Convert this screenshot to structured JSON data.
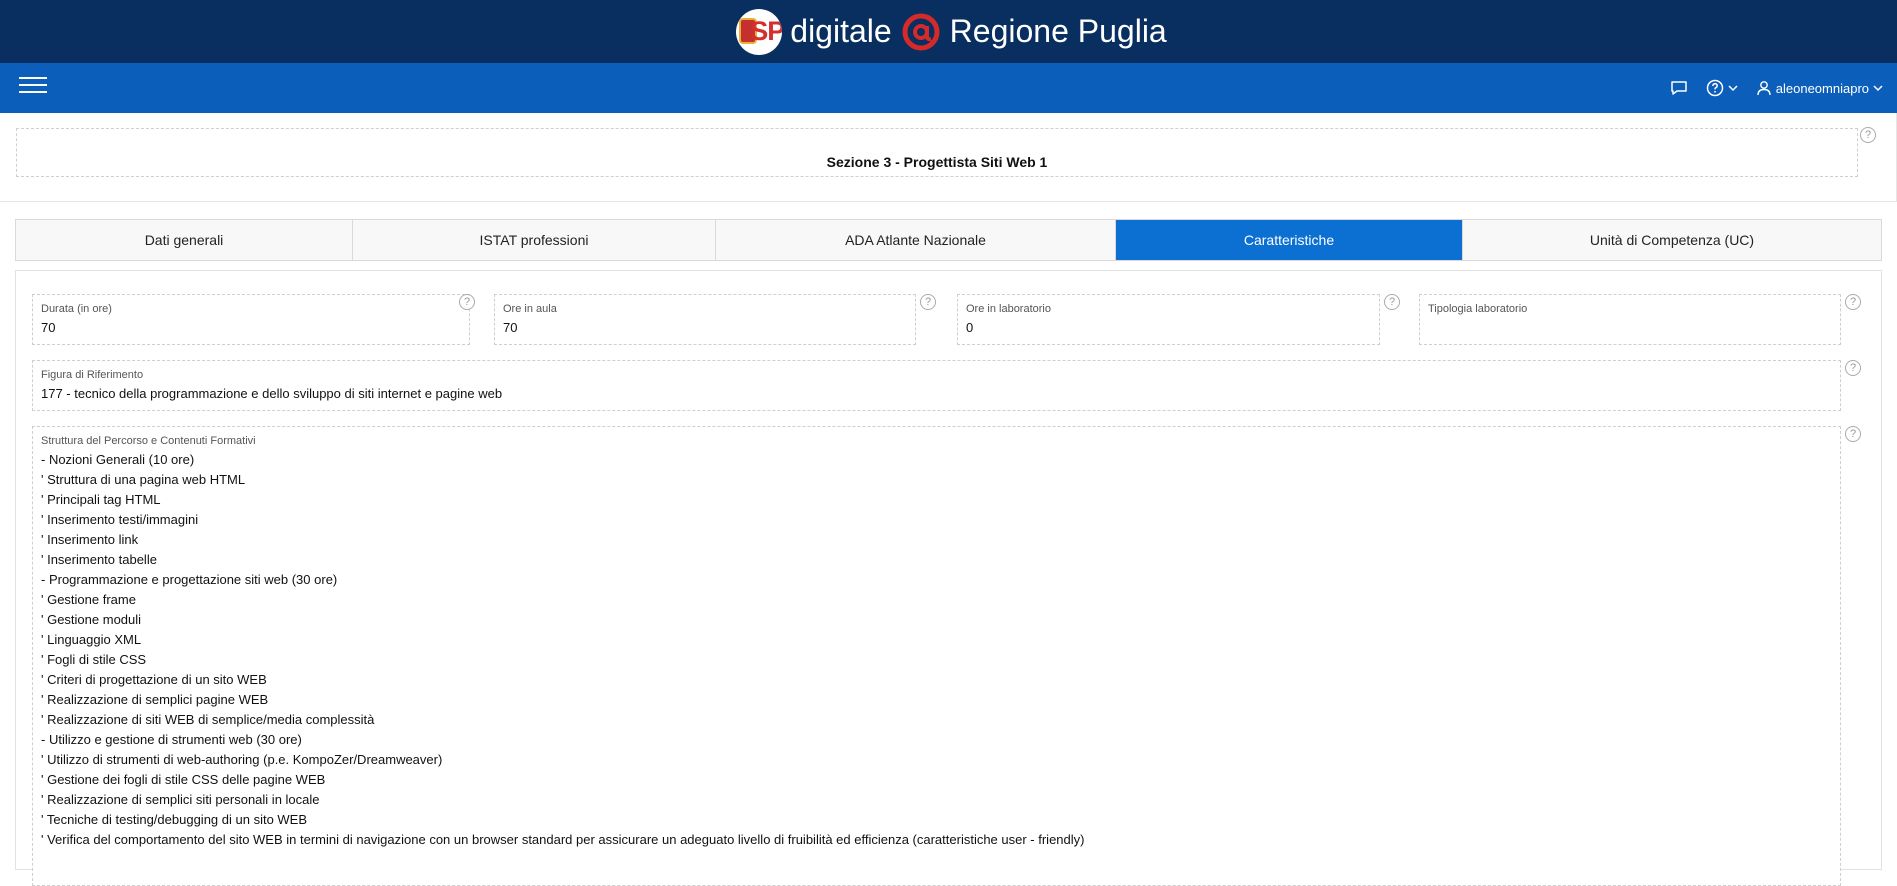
{
  "header": {
    "brand_left": "digitale",
    "brand_right": "Regione Puglia",
    "logo_text": "SP"
  },
  "nav": {
    "username": "aleoneomniapro"
  },
  "region": {
    "title": "Sezione 3 - Progettista Siti Web 1"
  },
  "tabs": [
    {
      "label": "Dati generali"
    },
    {
      "label": "ISTAT professioni"
    },
    {
      "label": "ADA Atlante Nazionale"
    },
    {
      "label": "Caratteristiche"
    },
    {
      "label": "Unità di Competenza (UC)"
    }
  ],
  "fields": {
    "durata": {
      "label": "Durata (in ore)",
      "value": "70"
    },
    "ore_aula": {
      "label": "Ore in aula",
      "value": "70"
    },
    "ore_laboratorio": {
      "label": "Ore in laboratorio",
      "value": "0"
    },
    "tipologia_laboratorio": {
      "label": "Tipologia laboratorio",
      "value": ""
    },
    "figura_riferimento": {
      "label": "Figura di Riferimento",
      "value": "177 - tecnico della programmazione e dello sviluppo di siti internet e pagine web"
    },
    "struttura": {
      "label": "Struttura del Percorso e Contenuti Formativi",
      "lines": [
        "- Nozioni Generali (10 ore)",
        "' Struttura di una pagina web HTML",
        "' Principali tag HTML",
        "' Inserimento testi/immagini",
        "' Inserimento link",
        "' Inserimento tabelle",
        "- Programmazione e progettazione siti web (30 ore)",
        "' Gestione frame",
        "' Gestione moduli",
        "' Linguaggio XML",
        "' Fogli di stile CSS",
        "' Criteri di progettazione di un sito WEB",
        "' Realizzazione di semplici pagine WEB",
        "' Realizzazione di siti WEB di semplice/media complessità",
        "- Utilizzo e gestione di strumenti web (30 ore)",
        "' Utilizzo di strumenti di web-authoring (p.e. KompoZer/Dreamweaver)",
        "' Gestione dei fogli di stile CSS delle pagine WEB",
        "' Realizzazione di semplici siti personali in locale",
        "' Tecniche di testing/debugging di un sito WEB",
        "' Verifica del comportamento del sito WEB in termini di navigazione con un browser standard per assicurare un adeguato livello di fruibilità ed efficienza (caratteristiche user - friendly)"
      ]
    }
  },
  "help_symbol": "?",
  "colors": {
    "topbar": "#082f5f",
    "navbar": "#0b5eba",
    "active_tab": "#0b70d1",
    "brand_at": "#d42a2a"
  }
}
